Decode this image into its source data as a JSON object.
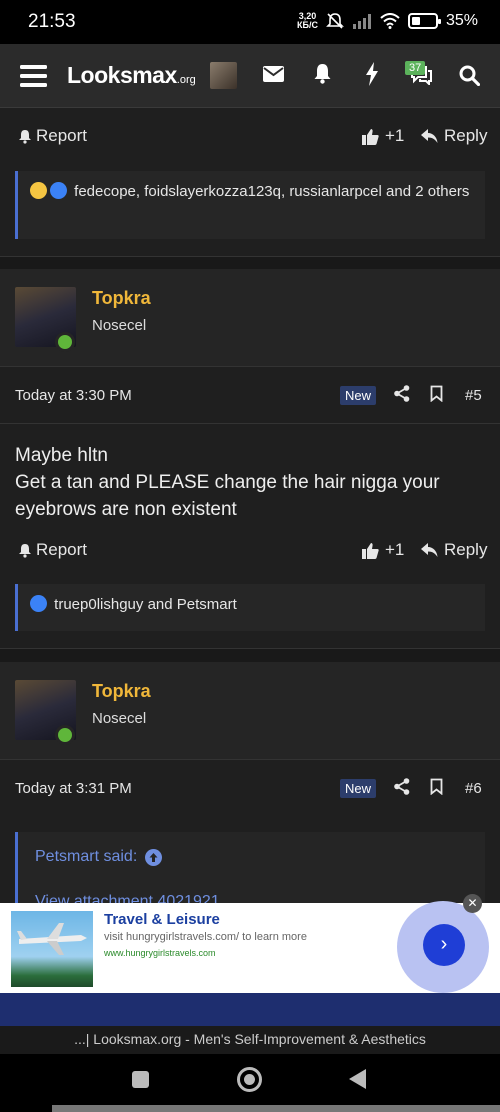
{
  "status": {
    "time": "21:53",
    "net_speed_value": "3,20",
    "net_speed_unit": "КБ/С",
    "battery": "35%",
    "battery_level": 0.35
  },
  "nav": {
    "logo_main": "Looksmax",
    "logo_suffix": ".org",
    "alerts_badge": "37"
  },
  "post4_footer": {
    "report": "Report",
    "like_count": "+1",
    "reply": "Reply",
    "reactions_text": "fedecope, foidslayerkozza123q, russianlarpcel and 2 others"
  },
  "post5": {
    "username": "Topkra",
    "rank": "Nosecel",
    "date": "Today at 3:30 PM",
    "new_tag": "New",
    "number": "#5",
    "body_lines": [
      "Maybe hltn",
      "Get a tan and PLEASE change the hair nigga your",
      "eyebrows are non existent"
    ],
    "report": "Report",
    "like_count": "+1",
    "reply": "Reply",
    "reactions_text": "truep0lishguy and Petsmart"
  },
  "post6": {
    "username": "Topkra",
    "rank": "Nosecel",
    "date": "Today at 3:31 PM",
    "new_tag": "New",
    "number": "#6",
    "quote_attribution": "Petsmart said:",
    "quote_partial": "View attachment 4021921"
  },
  "ad": {
    "title": "Travel & Leisure",
    "description": "visit hungrygirlstravels.com/ to learn more",
    "url": "www.hungrygirlstravels.com",
    "close_glyph": "✕",
    "go_glyph": "›"
  },
  "footer": {
    "text": "...| Looksmax.org - Men's Self-Improvement & Aesthetics"
  }
}
